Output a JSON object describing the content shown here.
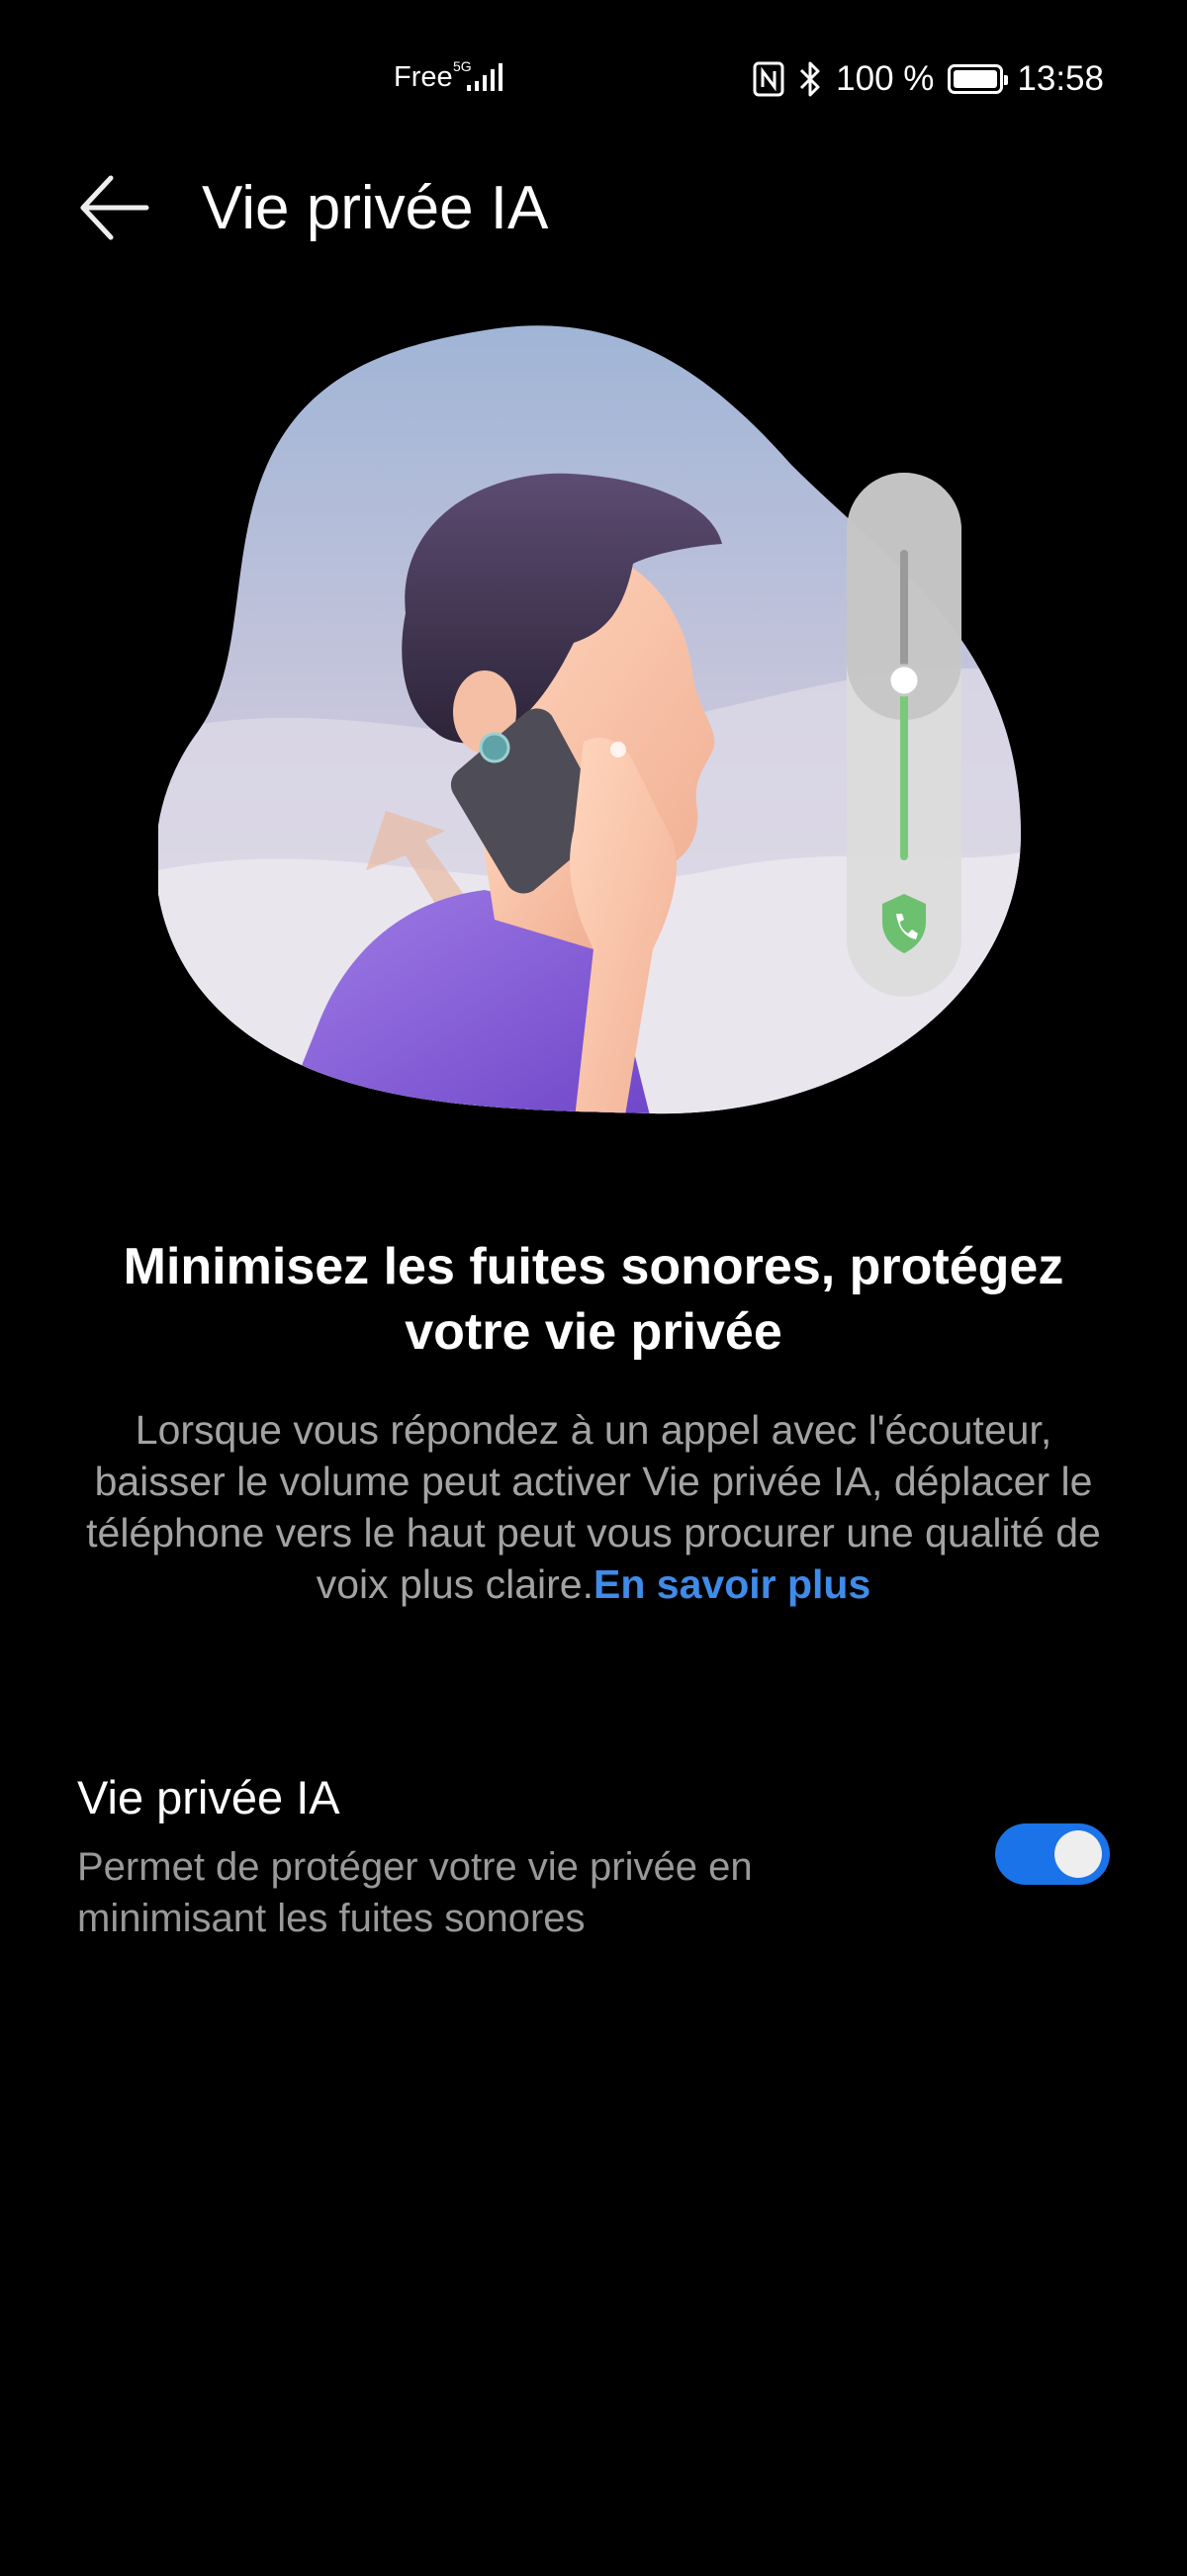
{
  "status_bar": {
    "carrier": "Free",
    "network": "5G",
    "battery": "100 %",
    "battery_level": 1.0,
    "time": "13:58",
    "icons": [
      "nfc-icon",
      "bluetooth-icon",
      "battery-icon",
      "signal-icon"
    ]
  },
  "header": {
    "title": "Vie privée IA",
    "back_icon": "arrow-left-icon"
  },
  "content": {
    "headline": "Minimisez les fuites sonores, protégez votre vie privée",
    "description": "Lorsque vous répondez à un appel avec l'écouteur, baisser le volume peut activer Vie privée IA, déplacer le téléphone vers le haut peut vous procurer une qualité de voix plus claire.",
    "learn_more": "En savoir plus"
  },
  "setting": {
    "title": "Vie privée IA",
    "subtitle": "Permet de protéger votre vie privée en minimisant les fuites sonores",
    "enabled": true
  },
  "colors": {
    "accent": "#1a73e8",
    "link": "#3f8be8",
    "volume_green": "#79c97a"
  }
}
